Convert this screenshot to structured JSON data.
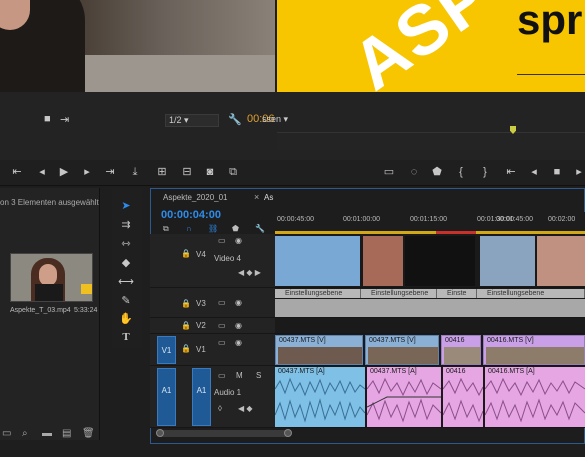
{
  "source_monitor": {
    "zoom": "1/2",
    "timecode": "00:06",
    "fit": "ssen"
  },
  "project_panel": {
    "status": "on 3 Elementen ausgewählt",
    "item": {
      "name": "Aspekte_T_03.mp4",
      "duration": "5:33:24"
    }
  },
  "program_monitor": {
    "title_text": "ASP",
    "text_right": "spr"
  },
  "timeline": {
    "tab_name": "Aspekte_2020_01",
    "tab_second": "As",
    "timecode": "00:00:04:00",
    "ruler": [
      "00:00:45:00",
      "00:01:00:00",
      "00:01:15:00",
      "00:01:30:00",
      "00:01:45:00",
      "00:02:00"
    ],
    "tracks": {
      "v4": {
        "label": "V4",
        "name": "Video 4"
      },
      "v3": {
        "label": "V3"
      },
      "v2": {
        "label": "V2"
      },
      "v1": {
        "label": "V1",
        "patch": "V1"
      },
      "a1": {
        "label": "A1",
        "patch": "A1",
        "name": "Audio 1",
        "m": "M",
        "s": "S"
      }
    },
    "adjustment_layers": [
      "Einstellungsebene",
      "Einstellungsebene",
      "Einste",
      "Einstellungsebene"
    ],
    "video_clips": [
      "00437.MTS [V]",
      "00437.MTS [V]",
      "00416",
      "00416.MTS [V]"
    ],
    "audio_clips": [
      "00437.MTS [A]",
      "00437.MTS [A]",
      "00416",
      "00416.MTS [A]"
    ]
  },
  "colors": {
    "accent": "#2d8ceb",
    "workbar": "#d2a816",
    "program_bg": "#f7c600"
  }
}
